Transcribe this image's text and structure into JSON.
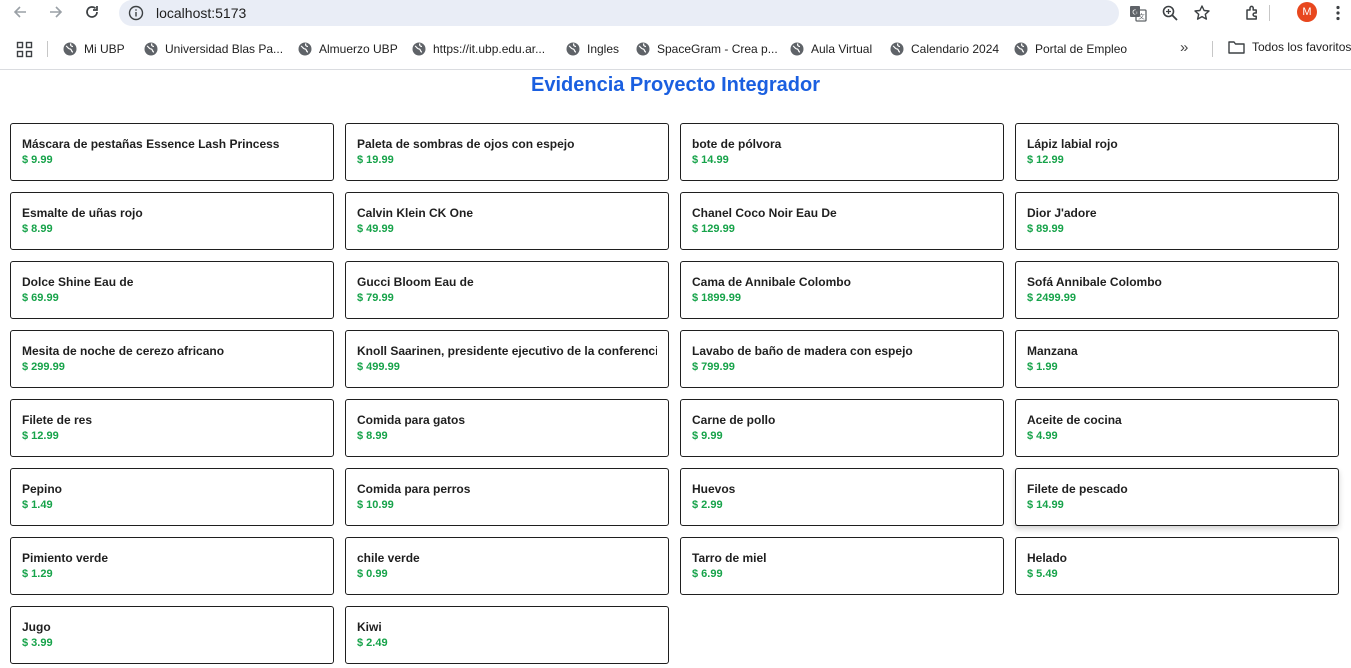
{
  "browser": {
    "url": "localhost:5173",
    "avatar_initial": "M",
    "icons": [
      "back-arrow-icon",
      "forward-arrow-icon",
      "reload-icon",
      "site-info-icon",
      "translate-icon",
      "zoom-icon",
      "star-icon",
      "extensions-icon",
      "kebab-menu-icon"
    ]
  },
  "bookmarks": {
    "items": [
      {
        "label": "Mi UBP"
      },
      {
        "label": "Universidad Blas Pa..."
      },
      {
        "label": "Almuerzo UBP"
      },
      {
        "label": "https://it.ubp.edu.ar..."
      },
      {
        "label": "Ingles"
      },
      {
        "label": "SpaceGram - Crea p..."
      },
      {
        "label": "Aula Virtual"
      },
      {
        "label": "Calendario 2024"
      },
      {
        "label": "Portal de Empleo"
      }
    ],
    "more": "»",
    "folder_label": "Todos los favoritos"
  },
  "page": {
    "title": "Evidencia Proyecto Integrador"
  },
  "products": [
    {
      "name": "Máscara de pestañas Essence Lash Princess",
      "price": "$ 9.99"
    },
    {
      "name": "Paleta de sombras de ojos con espejo",
      "price": "$ 19.99"
    },
    {
      "name": "bote de pólvora",
      "price": "$ 14.99"
    },
    {
      "name": "Lápiz labial rojo",
      "price": "$ 12.99"
    },
    {
      "name": "Esmalte de uñas rojo",
      "price": "$ 8.99"
    },
    {
      "name": "Calvin Klein CK One",
      "price": "$ 49.99"
    },
    {
      "name": "Chanel Coco Noir Eau De",
      "price": "$ 129.99"
    },
    {
      "name": "Dior J'adore",
      "price": "$ 89.99"
    },
    {
      "name": "Dolce Shine Eau de",
      "price": "$ 69.99"
    },
    {
      "name": "Gucci Bloom Eau de",
      "price": "$ 79.99"
    },
    {
      "name": "Cama de Annibale Colombo",
      "price": "$ 1899.99"
    },
    {
      "name": "Sofá Annibale Colombo",
      "price": "$ 2499.99"
    },
    {
      "name": "Mesita de noche de cerezo africano",
      "price": "$ 299.99"
    },
    {
      "name": "Knoll Saarinen, presidente ejecutivo de la conferencia",
      "price": "$ 499.99"
    },
    {
      "name": "Lavabo de baño de madera con espejo",
      "price": "$ 799.99"
    },
    {
      "name": "Manzana",
      "price": "$ 1.99"
    },
    {
      "name": "Filete de res",
      "price": "$ 12.99"
    },
    {
      "name": "Comida para gatos",
      "price": "$ 8.99"
    },
    {
      "name": "Carne de pollo",
      "price": "$ 9.99"
    },
    {
      "name": "Aceite de cocina",
      "price": "$ 4.99"
    },
    {
      "name": "Pepino",
      "price": "$ 1.49"
    },
    {
      "name": "Comida para perros",
      "price": "$ 10.99"
    },
    {
      "name": "Huevos",
      "price": "$ 2.99"
    },
    {
      "name": "Filete de pescado",
      "price": "$ 14.99"
    },
    {
      "name": "Pimiento verde",
      "price": "$ 1.29"
    },
    {
      "name": "chile verde",
      "price": "$ 0.99"
    },
    {
      "name": "Tarro de miel",
      "price": "$ 6.99"
    },
    {
      "name": "Helado",
      "price": "$ 5.49"
    },
    {
      "name": "Jugo",
      "price": "$ 3.99"
    },
    {
      "name": "Kiwi",
      "price": "$ 2.49"
    }
  ],
  "colors": {
    "title": "#1a5fe0",
    "price": "#17a34a",
    "omnibox": "#e9edf6",
    "avatar": "#e8471e"
  }
}
